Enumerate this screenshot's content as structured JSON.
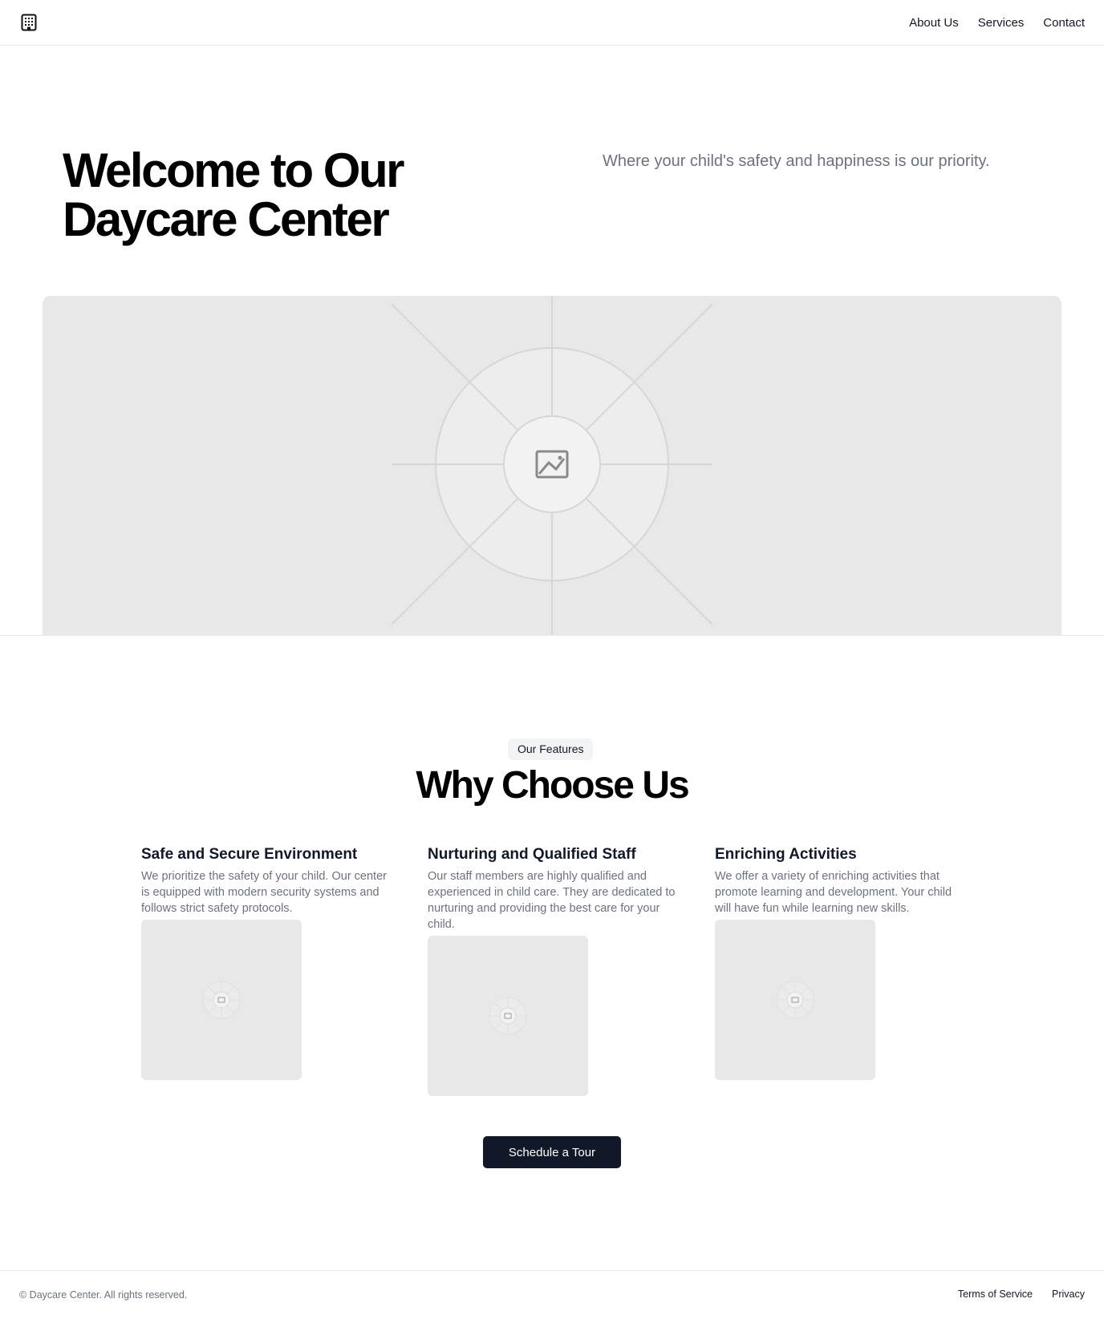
{
  "header": {
    "logo_icon": "building-icon",
    "nav": [
      {
        "label": "About Us"
      },
      {
        "label": "Services"
      },
      {
        "label": "Contact"
      }
    ]
  },
  "hero": {
    "title": "Welcome to Our Daycare Center",
    "subtitle": "Where your child's safety and happiness is our priority.",
    "image_icon": "image-placeholder-icon"
  },
  "features_section": {
    "badge": "Our Features",
    "title": "Why Choose Us",
    "items": [
      {
        "title": "Safe and Secure Environment",
        "description": "We prioritize the safety of your child. Our center is equipped with modern security systems and follows strict safety protocols.",
        "image_icon": "image-placeholder-icon"
      },
      {
        "title": "Nurturing and Qualified Staff",
        "description": "Our staff members are highly qualified and experienced in child care. They are dedicated to nurturing and providing the best care for your child.",
        "image_icon": "image-placeholder-icon"
      },
      {
        "title": "Enriching Activities",
        "description": "We offer a variety of enriching activities that promote learning and development. Your child will have fun while learning new skills.",
        "image_icon": "image-placeholder-icon"
      }
    ],
    "cta_label": "Schedule a Tour"
  },
  "footer": {
    "copyright": "© Daycare Center. All rights reserved.",
    "links": [
      {
        "label": "Terms of Service"
      },
      {
        "label": "Privacy"
      }
    ]
  },
  "colors": {
    "primary_button": "#111827",
    "muted_text": "#6b7280",
    "placeholder_bg": "#e8e8e8",
    "divider": "#e5e7eb"
  }
}
